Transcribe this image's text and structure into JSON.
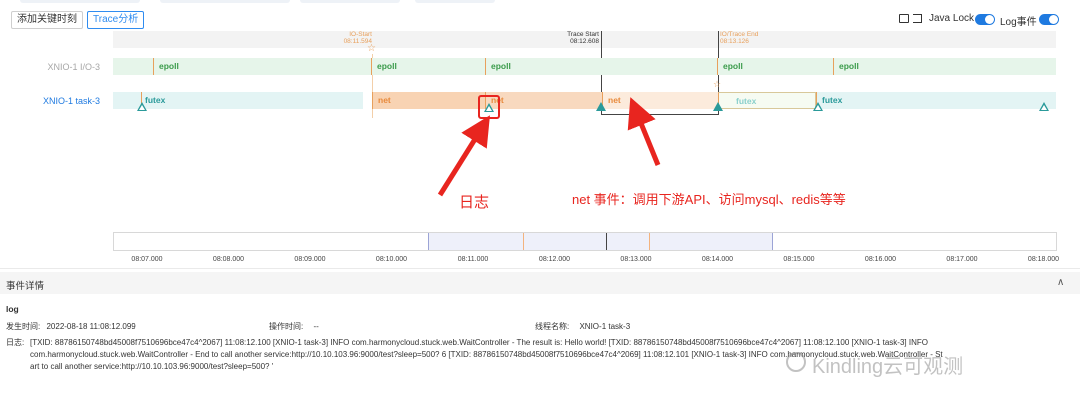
{
  "toolbar": {
    "add_keyframe_label": "添加关键时刻",
    "trace_analysis_label": "Trace分析",
    "java_lock_label": "Java Lock",
    "log_event_label": "Log事件"
  },
  "markers": {
    "io_start": {
      "title": "IO-Start",
      "time": "08:11.594"
    },
    "trace_start": {
      "title": "Trace Start",
      "time": "08:12.608"
    },
    "trace_end": {
      "title": "IO/Trace End",
      "time": "08:13.126"
    }
  },
  "threads": [
    {
      "name": "XNIO-1 I/O-3",
      "segments": [
        "epoll",
        "epoll",
        "epoll",
        "epoll",
        "epoll"
      ]
    },
    {
      "name": "XNIO-1 task-3",
      "segments": [
        "futex",
        "net",
        "net",
        "net",
        "futex",
        "futex"
      ]
    }
  ],
  "annotations": {
    "log": "日志",
    "net": "net 事件：调用下游API、访问mysql、redis等等"
  },
  "axis_ticks": [
    "08:07.000",
    "08:08.000",
    "08:09.000",
    "08:10.000",
    "08:11.000",
    "08:12.000",
    "08:13.000",
    "08:14.000",
    "08:15.000",
    "08:16.000",
    "08:17.000",
    "08:18.000"
  ],
  "detail": {
    "header": "事件详情",
    "type": "log",
    "time_label": "发生时间:",
    "time_value": "2022-08-18 11:08:12.099",
    "op_time_label": "操作时间:",
    "op_time_value": "--",
    "thread_label": "线程名称:",
    "thread_value": "XNIO-1 task-3",
    "log_label": "日志:",
    "log_line1": "[TXID: 88786150748bd45008f7510696bce47c4^2067] 11:08:12.100 [XNIO-1 task-3] INFO com.harmonycloud.stuck.web.WaitController - The result is:  Hello world!  [TXID: 88786150748bd45008f7510696bce47c4^2067] 11:08:12.100 [XNIO-1 task-3] INFO",
    "log_line2": "com.harmonycloud.stuck.web.WaitController - End to call another service:http://10.10.103.96:9000/test?sleep=500? 6 [TXID: 88786150748bd45008f7510696bce47c4^2069] 11:08:12.101 [XNIO-1 task-3] INFO com.harmonycloud.stuck.web.WaitController - St",
    "log_line3": "art to call another service:http://10.10.103.96:9000/test?sleep=500? '"
  },
  "watermark": "Kindling云可观测",
  "colors": {
    "epoll_bg": "#e6f5ea",
    "epoll_text": "#3a9b4a",
    "futex_bg": "#e3f4f4",
    "futex_text": "#2a9a9a",
    "net_bg": "#fcebdc",
    "net_text": "#e88a3c",
    "annotation_red": "#e8251f",
    "accent_blue": "#1f7ae0",
    "marker_orange": "#e8a05c"
  }
}
